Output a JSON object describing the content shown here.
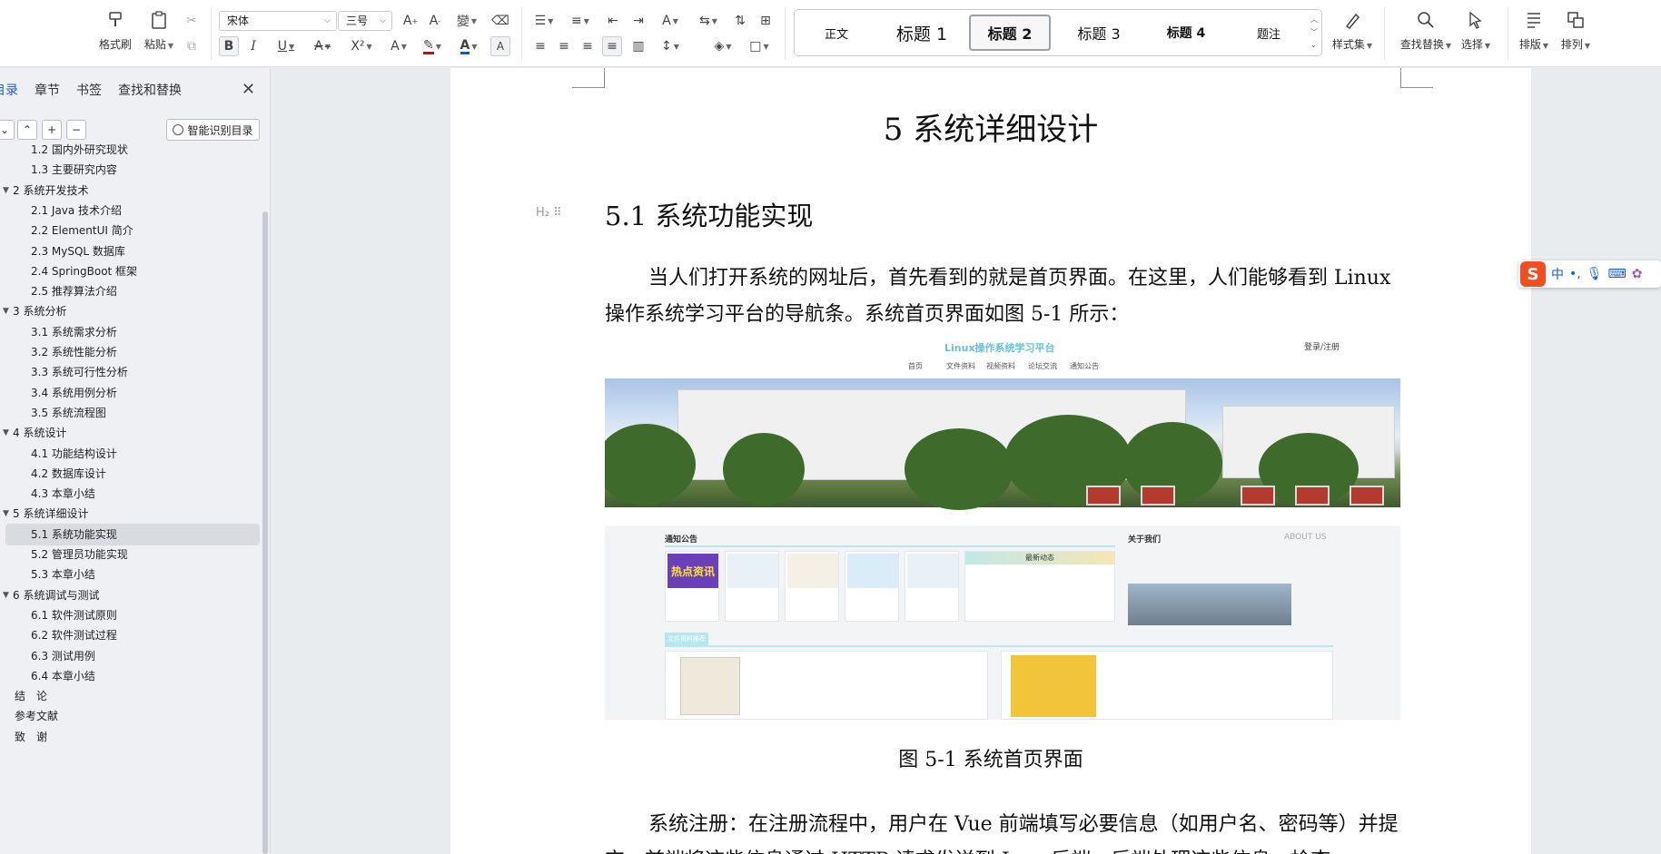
{
  "ribbon": {
    "format_painter": "格式刷",
    "paste": "粘贴",
    "font_name": "宋体",
    "font_size": "三号",
    "style_set": "样式集",
    "find_replace": "查找替换",
    "select": "选择",
    "layout": "排版",
    "arrange": "排列",
    "styles": [
      {
        "label": "正文"
      },
      {
        "label": "标题 1"
      },
      {
        "label": "标题 2"
      },
      {
        "label": "标题 3"
      },
      {
        "label": "标题 4"
      },
      {
        "label": "题注"
      }
    ],
    "active_style": "标题 2",
    "font_color": "#d0021b",
    "text_color": "#1a50d6"
  },
  "nav": {
    "tabs": [
      {
        "label": "目录",
        "active": true
      },
      {
        "label": "章节",
        "active": false
      },
      {
        "label": "书签",
        "active": false
      },
      {
        "label": "查找和替换",
        "active": false
      }
    ],
    "smart_toc_label": "智能识别目录",
    "toc": [
      {
        "label": "1.2 国内外研究现状",
        "level": 2
      },
      {
        "label": "1.3 主要研究内容",
        "level": 2
      },
      {
        "label": "2 系统开发技术",
        "level": 1
      },
      {
        "label": "2.1 Java 技术介绍",
        "level": 2
      },
      {
        "label": "2.2 ElementUI 简介",
        "level": 2
      },
      {
        "label": "2.3 MySQL 数据库",
        "level": 2
      },
      {
        "label": "2.4 SpringBoot 框架",
        "level": 2
      },
      {
        "label": "2.5 推荐算法介绍",
        "level": 2
      },
      {
        "label": "3 系统分析",
        "level": 1
      },
      {
        "label": "3.1 系统需求分析",
        "level": 2
      },
      {
        "label": "3.2 系统性能分析",
        "level": 2
      },
      {
        "label": "3.3 系统可行性分析",
        "level": 2
      },
      {
        "label": "3.4 系统用例分析",
        "level": 2
      },
      {
        "label": "3.5  系统流程图",
        "level": 2
      },
      {
        "label": "4  系统设计",
        "level": 1
      },
      {
        "label": "4.1 功能结构设计",
        "level": 2
      },
      {
        "label": "4.2 数据库设计",
        "level": 2
      },
      {
        "label": "4.3 本章小结",
        "level": 2
      },
      {
        "label": "5 系统详细设计",
        "level": 1
      },
      {
        "label": "5.1 系统功能实现",
        "level": 2,
        "selected": true
      },
      {
        "label": "5.2 管理员功能实现",
        "level": 2
      },
      {
        "label": "5.3 本章小结",
        "level": 2
      },
      {
        "label": "6  系统调试与测试",
        "level": 1
      },
      {
        "label": "6.1 软件测试原则",
        "level": 2
      },
      {
        "label": "6.2 软件测试过程",
        "level": 2
      },
      {
        "label": "6.3 测试用例",
        "level": 2
      },
      {
        "label": "6.4 本章小结",
        "level": 2
      },
      {
        "label": "结　论",
        "level": 0
      },
      {
        "label": "参考文献",
        "level": 0
      },
      {
        "label": "致　谢",
        "level": 0
      }
    ]
  },
  "document": {
    "heading1": "5 系统详细设计",
    "heading2_marker": "H₂",
    "heading2": "5.1 系统功能实现",
    "para1": "当人们打开系统的网址后，首先看到的就是首页界面。在这里，人们能够看到 Linux 操作系统学习平台的导航条。系统首页界面如图 5-1 所示：",
    "figure": {
      "site_title": "Linux操作系统学习平台",
      "login": "登录/注册",
      "menu": [
        "首页",
        "文件资料",
        "视频资料",
        "论坛交流",
        "通知公告"
      ],
      "notice_title": "通知公告",
      "about_title": "关于我们",
      "about_en": "ABOUT US",
      "latest": "最新动态",
      "files_title": "文件资料推荐",
      "hot_label": "热点资讯"
    },
    "caption": "图 5-1  系统首页界面",
    "para2": "系统注册：在注册流程中，用户在 Vue 前端填写必要信息（如用户名、密码等）并提交。前端将这些信息通过 HTTP 请求发送到 Java 后端。后端处理这些信息，检查"
  },
  "ime": {
    "lang": "中"
  }
}
